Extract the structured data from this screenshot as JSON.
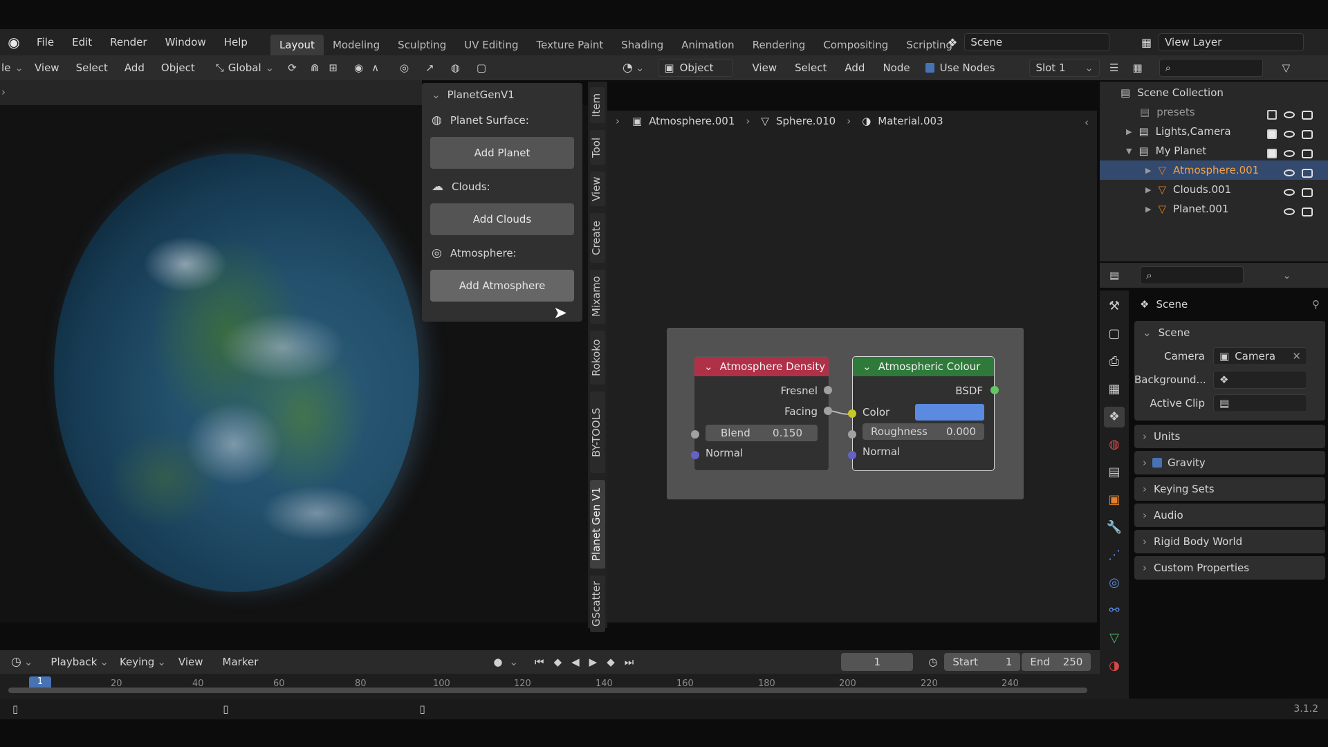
{
  "menus": [
    "File",
    "Edit",
    "Render",
    "Window",
    "Help"
  ],
  "workspaces": [
    "Layout",
    "Modeling",
    "Sculpting",
    "UV Editing",
    "Texture Paint",
    "Shading",
    "Animation",
    "Rendering",
    "Compositing",
    "Scripting"
  ],
  "active_workspace": "Layout",
  "scene_field": "Scene",
  "view_layer_field": "View Layer",
  "viewport_header": {
    "mode_partial": "le",
    "items": [
      "View",
      "Select",
      "Add",
      "Object"
    ],
    "transform": "Global"
  },
  "npanel": {
    "title": "PlanetGenV1",
    "sections": [
      {
        "label": "Planet Surface:",
        "button": "Add Planet"
      },
      {
        "label": "Clouds:",
        "button": "Add Clouds"
      },
      {
        "label": "Atmosphere:",
        "button": "Add Atmosphere"
      }
    ],
    "tabs": [
      "Item",
      "Tool",
      "View",
      "Create",
      "Mixamo",
      "Rokoko",
      "BY-TOOLS",
      "Planet Gen V1",
      "GScatter"
    ],
    "active_tab": "Planet Gen V1"
  },
  "node_header": {
    "mode": "Object",
    "items": [
      "View",
      "Select",
      "Add",
      "Node"
    ],
    "use_nodes_label": "Use Nodes",
    "slot": "Slot 1"
  },
  "breadcrumb": [
    "Atmosphere.001",
    "Sphere.010",
    "Material.003"
  ],
  "nodes": {
    "density": {
      "title": "Atmosphere Density",
      "outputs": [
        "Fresnel",
        "Facing"
      ],
      "blend_label": "Blend",
      "blend_value": "0.150",
      "normal_label": "Normal",
      "header_color": "#b03048"
    },
    "colour": {
      "title": "Atmospheric Colour",
      "output": "BSDF",
      "color_label": "Color",
      "color_value": "#5b8ae0",
      "roughness_label": "Roughness",
      "roughness_value": "0.000",
      "normal_label": "Normal",
      "header_color": "#2f7a3a"
    }
  },
  "outliner": {
    "root": "Scene Collection",
    "rows": [
      {
        "name": "presets",
        "indent": 1,
        "dim": true
      },
      {
        "name": "Lights,Camera",
        "indent": 1
      },
      {
        "name": "My Planet",
        "indent": 1
      },
      {
        "name": "Atmosphere.001",
        "indent": 2,
        "selected": true
      },
      {
        "name": "Clouds.001",
        "indent": 2
      },
      {
        "name": "Planet.001",
        "indent": 2
      }
    ]
  },
  "properties": {
    "context": "Scene",
    "section": "Scene",
    "camera_label": "Camera",
    "camera_value": "Camera",
    "background_label": "Background...",
    "active_clip_label": "Active Clip",
    "panels": [
      "Units",
      "Gravity",
      "Keying Sets",
      "Audio",
      "Rigid Body World",
      "Custom Properties"
    ]
  },
  "timeline": {
    "menus": [
      "Playback",
      "Keying",
      "View",
      "Marker"
    ],
    "current_frame": "1",
    "start_label": "Start",
    "start_value": "1",
    "end_label": "End",
    "end_value": "250",
    "ticks": [
      "20",
      "40",
      "60",
      "80",
      "100",
      "120",
      "140",
      "160",
      "180",
      "200",
      "220",
      "240"
    ],
    "cursor_frame": "1"
  },
  "version": "3.1.2",
  "colors": {
    "accent": "#4772b3",
    "selected_row": "#33496e",
    "orange": "#e0812e"
  }
}
